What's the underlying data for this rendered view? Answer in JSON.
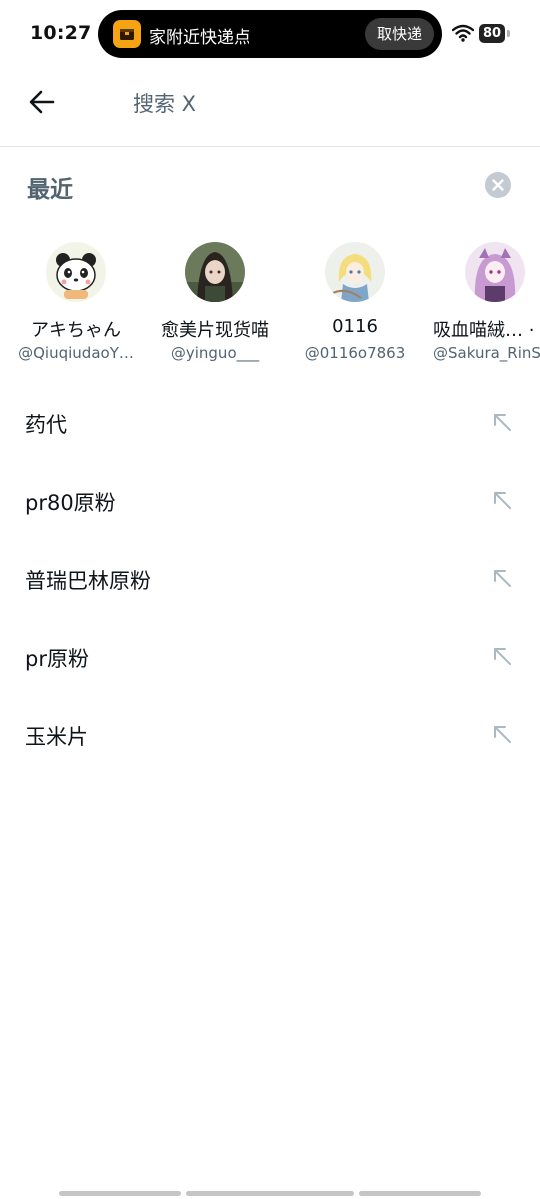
{
  "status_bar": {
    "time": "10:27",
    "island_text": "家附近快递点",
    "island_button": "取快递",
    "battery": "80",
    "icons": [
      "package-app-icon",
      "wifi-icon",
      "battery-icon"
    ]
  },
  "header": {
    "search_value": "搜索 X",
    "icons": [
      "back-arrow-icon"
    ]
  },
  "recent": {
    "title": "最近",
    "clear_icon": "close-icon",
    "users": [
      {
        "name": "アキちゃん",
        "handle": "@QiuqiudaoY…"
      },
      {
        "name": "愈美片现货喵",
        "handle": "@yinguo___"
      },
      {
        "name": "0116",
        "handle": "@0116o7863"
      },
      {
        "name": "吸血喵絨… ·",
        "handle": "@Sakura_RinS"
      }
    ]
  },
  "history": {
    "items": [
      {
        "query": "药代"
      },
      {
        "query": "pr80原粉"
      },
      {
        "query": "普瑞巴林原粉"
      },
      {
        "query": "pr原粉"
      },
      {
        "query": "玉米片"
      }
    ],
    "fill_icon": "arrow-up-left-icon"
  },
  "colors": {
    "primary_text": "#0f1419",
    "secondary_text": "#536471",
    "divider": "#e2e5e8",
    "clear_button": "#c3cad2",
    "fill_arrow": "#aab8c2",
    "island_bg": "#000000",
    "app_icon": "#f5a312"
  }
}
